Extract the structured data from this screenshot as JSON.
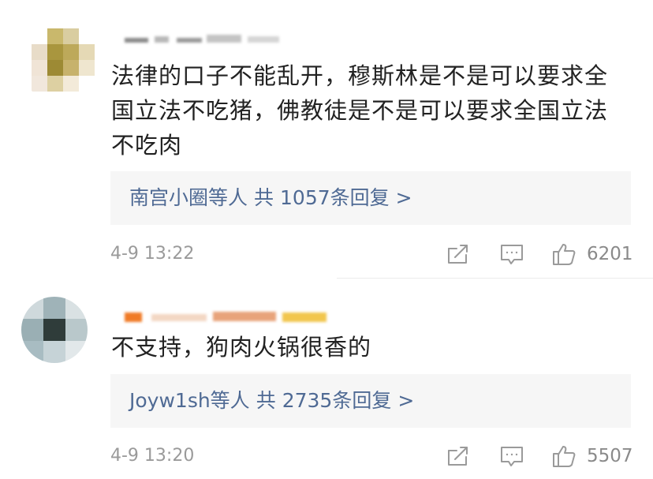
{
  "comments": [
    {
      "text": "法律的口子不能乱开，穆斯林是不是可以要求全\n国立法不吃猪，佛教徒是不是可以要求全国立法\n不吃肉",
      "replies": {
        "names": "南宫小圈等人",
        "prefix": "共",
        "count": "1057",
        "suffix": "条回复",
        "arrow": ">"
      },
      "timestamp": "4-9 13:22",
      "likes": "6201",
      "icons": [
        "share-icon",
        "comment-icon",
        "like-icon"
      ]
    },
    {
      "text": "不支持，狗肉火锅很香的",
      "replies": {
        "names": "Joyw1sh等人",
        "prefix": "共",
        "count": "2735",
        "suffix": "条回复",
        "arrow": ">"
      },
      "timestamp": "4-9 13:20",
      "likes": "5507",
      "icons": [
        "share-icon",
        "comment-icon",
        "like-icon"
      ]
    }
  ],
  "colors": {
    "link": "#4f6a94",
    "text": "#222222",
    "meta": "#9a9a9a",
    "reply_bg": "#f6f6f6"
  }
}
